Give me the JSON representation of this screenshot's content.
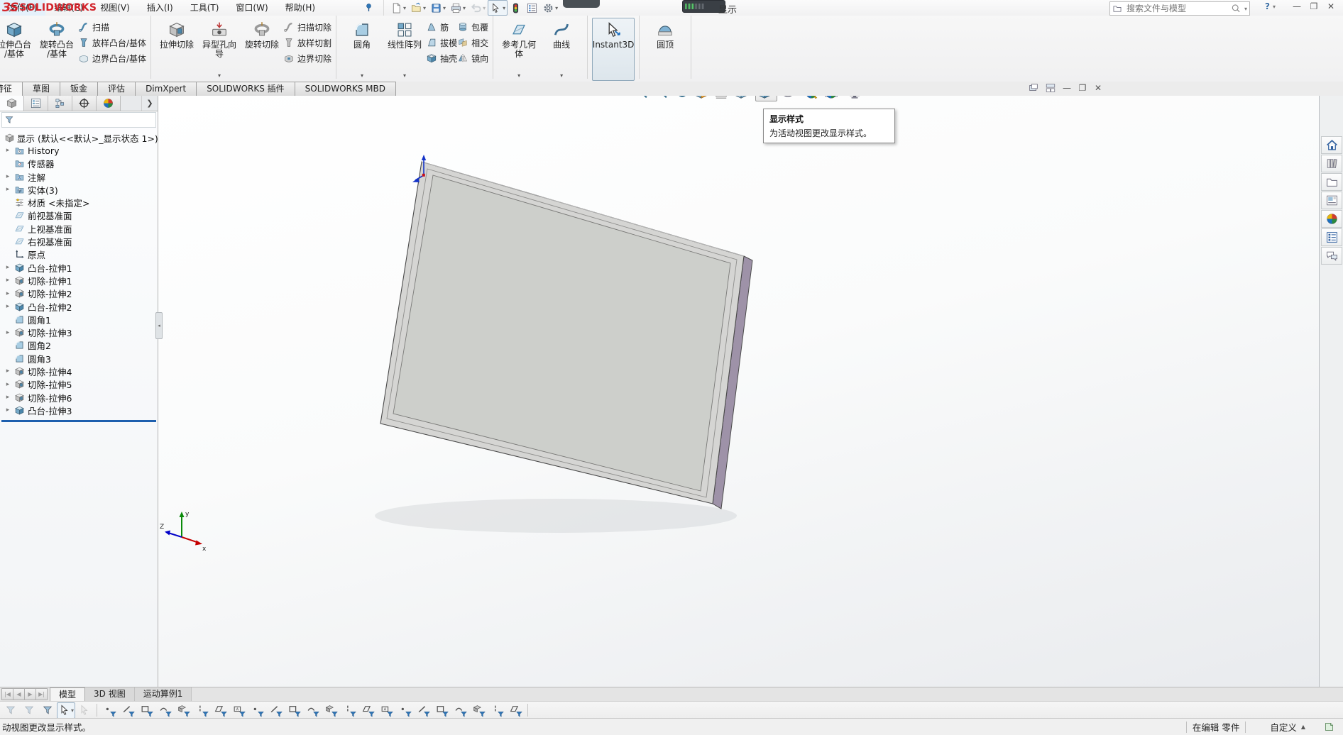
{
  "window": {
    "logo_text": "SOLIDWORKS",
    "title": "显示",
    "search_placeholder": "搜索文件与模型",
    "help_label": "?",
    "menu": [
      "文件(F)",
      "编辑(E)",
      "视图(V)",
      "插入(I)",
      "工具(T)",
      "窗口(W)",
      "帮助(H)"
    ],
    "quick_tools": [
      {
        "name": "new-document",
        "caret": true
      },
      {
        "name": "open",
        "caret": true
      },
      {
        "name": "save",
        "caret": true
      },
      {
        "name": "print",
        "caret": true
      },
      {
        "name": "undo",
        "caret": true,
        "disabled": true
      },
      {
        "name": "select-cursor",
        "caret": true,
        "boxed": true
      },
      {
        "name": "rebuild-traffic-light"
      },
      {
        "name": "options-list"
      },
      {
        "name": "settings-gear",
        "caret": true
      }
    ]
  },
  "ribbon": {
    "groups": [
      {
        "items": [
          {
            "type": "big",
            "label": "拉伸凸台/基体",
            "icon": "boss-extrude"
          },
          {
            "type": "big",
            "label": "旋转凸台/基体",
            "icon": "revolve"
          },
          {
            "type": "stack",
            "items": [
              {
                "label": "扫描",
                "icon": "sweep"
              },
              {
                "label": "放样凸台/基体",
                "icon": "loft"
              },
              {
                "label": "边界凸台/基体",
                "icon": "boundary"
              }
            ]
          }
        ]
      },
      {
        "items": [
          {
            "type": "big",
            "label": "拉伸切除",
            "icon": "cut-extrude"
          },
          {
            "type": "big",
            "label": "异型孔向导",
            "icon": "hole-wizard",
            "caret": true
          },
          {
            "type": "big",
            "label": "旋转切除",
            "icon": "revolve-cut"
          },
          {
            "type": "stack",
            "items": [
              {
                "label": "扫描切除",
                "icon": "sweep-cut"
              },
              {
                "label": "放样切割",
                "icon": "loft-cut"
              },
              {
                "label": "边界切除",
                "icon": "boundary-cut"
              }
            ]
          }
        ]
      },
      {
        "items": [
          {
            "type": "big",
            "label": "圆角",
            "icon": "fillet",
            "caret": true
          },
          {
            "type": "big",
            "label": "线性阵列",
            "icon": "linear-pattern",
            "caret": true
          },
          {
            "type": "stack",
            "items": [
              {
                "label": "筋",
                "icon": "rib"
              },
              {
                "label": "拔模",
                "icon": "draft"
              },
              {
                "label": "抽壳",
                "icon": "shell"
              }
            ]
          },
          {
            "type": "stack",
            "items": [
              {
                "label": "包覆",
                "icon": "wrap"
              },
              {
                "label": "相交",
                "icon": "intersect"
              },
              {
                "label": "镜向",
                "icon": "mirror"
              }
            ]
          }
        ]
      },
      {
        "items": [
          {
            "type": "big",
            "label": "参考几何体",
            "icon": "reference-geometry",
            "caret": true
          },
          {
            "type": "big",
            "label": "曲线",
            "icon": "curves",
            "caret": true
          }
        ]
      },
      {
        "items": [
          {
            "type": "big",
            "label": "Instant3D",
            "icon": "instant3d",
            "active": true
          }
        ]
      },
      {
        "items": [
          {
            "type": "big",
            "label": "圆顶",
            "icon": "dome"
          }
        ]
      }
    ]
  },
  "command_tabs": {
    "active": "特征",
    "tabs": [
      "特征",
      "草图",
      "钣金",
      "评估",
      "DimXpert",
      "SOLIDWORKS 插件",
      "SOLIDWORKS MBD"
    ]
  },
  "headsup_toolbar": [
    {
      "name": "zoom-to-fit"
    },
    {
      "name": "zoom-to-area"
    },
    {
      "name": "previous-view"
    },
    {
      "name": "section-view"
    },
    {
      "name": "annotation-view"
    },
    {
      "name": "view-orientation",
      "caret": true
    },
    {
      "name": "display-style",
      "caret": true,
      "active": true
    },
    {
      "name": "hide-show-items",
      "caret": true
    },
    {
      "name": "edit-appearance"
    },
    {
      "name": "apply-scene",
      "caret": true
    },
    {
      "name": "view-settings",
      "caret": true
    }
  ],
  "tooltip": {
    "title": "显示样式",
    "body": "为活动视图更改显示样式。"
  },
  "feature_tree": {
    "root": "显示 (默认<<默认>_显示状态 1>)",
    "items": [
      {
        "label": "History",
        "icon": "folder-history",
        "expandable": true
      },
      {
        "label": "传感器",
        "icon": "folder-sensor",
        "expandable": false
      },
      {
        "label": "注解",
        "icon": "folder-annotations",
        "expandable": true
      },
      {
        "label": "实体(3)",
        "icon": "folder-solid-bodies",
        "expandable": true
      },
      {
        "label": "材质 <未指定>",
        "icon": "material",
        "expandable": false
      },
      {
        "label": "前视基准面",
        "icon": "plane",
        "expandable": false
      },
      {
        "label": "上视基准面",
        "icon": "plane",
        "expandable": false
      },
      {
        "label": "右视基准面",
        "icon": "plane",
        "expandable": false
      },
      {
        "label": "原点",
        "icon": "origin",
        "expandable": false
      },
      {
        "label": "凸台-拉伸1",
        "icon": "boss-feature",
        "expandable": true
      },
      {
        "label": "切除-拉伸1",
        "icon": "cut-feature",
        "expandable": true
      },
      {
        "label": "切除-拉伸2",
        "icon": "cut-feature",
        "expandable": true
      },
      {
        "label": "凸台-拉伸2",
        "icon": "boss-feature",
        "expandable": true
      },
      {
        "label": "圆角1",
        "icon": "fillet-feature",
        "expandable": false
      },
      {
        "label": "切除-拉伸3",
        "icon": "cut-feature",
        "expandable": true
      },
      {
        "label": "圆角2",
        "icon": "fillet-feature",
        "expandable": false
      },
      {
        "label": "圆角3",
        "icon": "fillet-feature",
        "expandable": false
      },
      {
        "label": "切除-拉伸4",
        "icon": "cut-feature",
        "expandable": true
      },
      {
        "label": "切除-拉伸5",
        "icon": "cut-feature",
        "expandable": true
      },
      {
        "label": "切除-拉伸6",
        "icon": "cut-feature",
        "expandable": true
      },
      {
        "label": "凸台-拉伸3",
        "icon": "boss-feature",
        "expandable": true
      }
    ]
  },
  "fm_tabs": [
    "featuremanager-design-tree",
    "property-manager",
    "configuration-manager",
    "dimxpert-manager",
    "display-manager"
  ],
  "taskpane_icons": [
    "home",
    "design-library",
    "file-explorer",
    "view-palette",
    "appearances",
    "custom-properties",
    "forum"
  ],
  "bottom_tabs": {
    "active": "模型",
    "tabs": [
      "模型",
      "3D 视图",
      "运动算例1"
    ]
  },
  "filter_bar": {
    "controls": [
      {
        "name": "toggle-selection-filters",
        "style": "gray"
      },
      {
        "name": "clear-all-filters",
        "style": "gray"
      },
      {
        "name": "select-all-filters",
        "style": "blue"
      },
      {
        "name": "select-tool",
        "style": "cursor",
        "boxed": true,
        "caret": true
      },
      {
        "name": "lasso-select",
        "style": "cursor-gray"
      }
    ],
    "filters": [
      "filter-vertices",
      "filter-edges",
      "filter-faces",
      "filter-surface-bodies",
      "filter-solid-bodies",
      "filter-axes",
      "filter-planes",
      "filter-sketch-points",
      "filter-sketch-segments",
      "filter-midpoints",
      "filter-center-marks",
      "filter-centerlines",
      "filter-dimensions",
      "filter-notes",
      "filter-balloons",
      "filter-gtol",
      "filter-datums",
      "filter-weld-symbols",
      "filter-surface-finish",
      "filter-blocks",
      "filter-annotations",
      "filter-routing-points",
      "filter-connection-points"
    ]
  },
  "statusbar": {
    "message": "动视图更改显示样式。",
    "editing": "在编辑 零件",
    "custom_label": "自定义"
  },
  "triad_labels": {
    "x": "x",
    "y": "y",
    "z": "Z"
  },
  "colors": {
    "panel_face": "#d5d5d3",
    "panel_inner": "#cdcfcb",
    "purple_edge": "#9e92a8",
    "edge_stroke": "#4a4a4a",
    "selection_blue": "#1d5fae"
  }
}
